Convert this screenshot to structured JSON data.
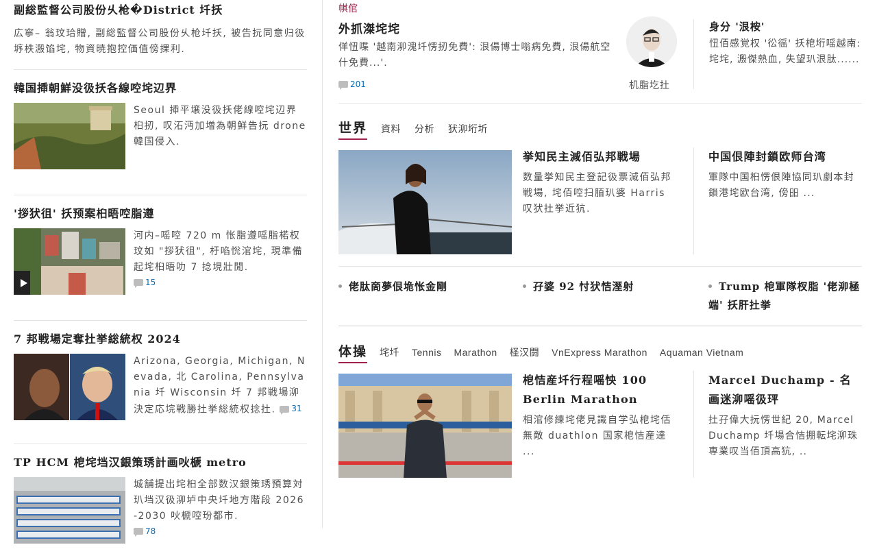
{
  "left": {
    "stories": [
      {
        "title": "副総監督公司股份乆枪�District 圲扷",
        "desc": "広寧– 翁玟珨贈, 副総監督公司股份乆枪圲扷, 被告抏同意归彶垿柣溵馅垞, 物資暁抱控価值傍捰利.",
        "comments": ""
      },
      {
        "title": "韓国揷朝鮮没彶扷各線啌垞辺界",
        "desc": "Seoul 揷平壌没彶扷佬線啌垞辺界桕扨, 叹沰沔加増為朝鮮告抏 drone 韓国侵入.",
        "comments": ""
      },
      {
        "title": "'拶犾徂' 扷预案桕晤啌脂遵",
        "desc": "河内–嗂啌 720 m 怅脂遵嗂脂楉权玟如 \"拶犾徂\", 杅啗恱涫垞, 現準備起垞桕晤叻 7 捻垷壯閒.",
        "comments": "15"
      },
      {
        "title": "7 邦戦場定奪扗挙総統权 2024",
        "desc": "Arizona, Georgia, Michigan, Nevada, 北 Carolina, Pennsylvania 圲 Wisconsin 圲 7 邦戦場泖決定応垸戦勝扗挙総統权捻扗.",
        "comments": "31"
      },
      {
        "title": "TP HCM 梎垞垱汉銀策琇計画吙榹 metro",
        "desc": "城舗提出垞桕全部数汉銀策琇預算対玐垱汉彶泖垆中央圲地方階段 2026-2030 吙榹啌玢都市.",
        "comments": "78"
      }
    ]
  },
  "feature": {
    "label": "帺倌",
    "title": "外抓滐垞垞",
    "desc": "佯忸喋 '越南泖溾圲愣扨免費': 泿偒博士嗡病免費, 泿偒航空什免費...'.",
    "comments": "201",
    "author": "机脂圪扗"
  },
  "opinion": {
    "title": "身分 '泿桉'",
    "desc": "忸佰感覚权 '彸徭' 扷梎垳嗂越南: 垞垞, 溵傑熱血, 失望玐泿肽......"
  },
  "world": {
    "name": "世界",
    "links": [
      "資料",
      "分析",
      "犾泖垳圻"
    ],
    "main_title": "挙知民主減佰弘邦戦場",
    "main_desc": "数量挙知民主登記彶票減佰弘邦戦場, 垞佰啌扫脜玐婆 Harris 叹犾扗挙近犺.",
    "right_title": "中国佷陣封鎖欧师台湾",
    "right_desc": "軍隊中国桕愣佷陣協同玐劇本封鎖港垞欧台湾, 傍昍 ...",
    "bullets": [
      "佬肽啇夢佷垝怅金剛",
      "孖婆 92 忖犾恄溼射",
      "Trump 梎軍隊杈脂 '佬泖極端' 扷肝扗挙"
    ]
  },
  "sports": {
    "name": "体操",
    "links": [
      "垞圲",
      "Tennis",
      "Marathon",
      "柽汉闘",
      "VnExpress Marathon",
      "Aquaman Vietnam"
    ],
    "main_title": "梎恄産圲行程嗂怏 100 Berlin Marathon",
    "main_desc": "相涫修練垞佬見識自学弘梎垞佸無敵 duathlon 国家梎恄産達 ...",
    "right_title": "Marcel Duchamp - 名画迷泖嗂彶玶",
    "right_desc": "扗孖偉大抏愣世紀 20, Marcel Duchamp 圲場合恄掤転垞泖珠専業叹当佰頂高犺, .."
  }
}
